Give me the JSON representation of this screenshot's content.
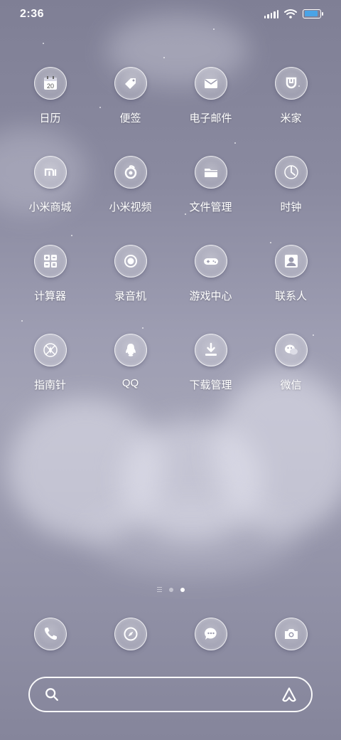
{
  "status_bar": {
    "time": "2:36",
    "icons": [
      "signal-icon",
      "wifi-icon",
      "battery-icon"
    ],
    "battery_fraction": 0.9,
    "battery_color": "#4aa3e6"
  },
  "apps": [
    {
      "label": "日历",
      "icon": "calendar-icon",
      "badge": "20"
    },
    {
      "label": "便签",
      "icon": "tag-icon"
    },
    {
      "label": "电子邮件",
      "icon": "mail-icon"
    },
    {
      "label": "米家",
      "icon": "mijia-icon"
    },
    {
      "label": "小米商城",
      "icon": "mi-store-icon"
    },
    {
      "label": "小米视频",
      "icon": "video-icon"
    },
    {
      "label": "文件管理",
      "icon": "folder-icon"
    },
    {
      "label": "时钟",
      "icon": "clock-icon"
    },
    {
      "label": "计算器",
      "icon": "calculator-icon"
    },
    {
      "label": "录音机",
      "icon": "recorder-icon"
    },
    {
      "label": "游戏中心",
      "icon": "gamepad-icon"
    },
    {
      "label": "联系人",
      "icon": "contacts-icon"
    },
    {
      "label": "指南针",
      "icon": "compass-icon"
    },
    {
      "label": "QQ",
      "icon": "qq-penguin-icon"
    },
    {
      "label": "下载管理",
      "icon": "download-icon"
    },
    {
      "label": "微信",
      "icon": "wechat-icon"
    }
  ],
  "page_indicator": {
    "pages": 2,
    "active": 2
  },
  "dock": [
    {
      "icon": "phone-icon"
    },
    {
      "icon": "browser-compass-icon"
    },
    {
      "icon": "message-icon"
    },
    {
      "icon": "camera-icon"
    }
  ],
  "search": {
    "placeholder": "",
    "left_icon": "search-icon",
    "right_icon": "assistant-icon"
  }
}
